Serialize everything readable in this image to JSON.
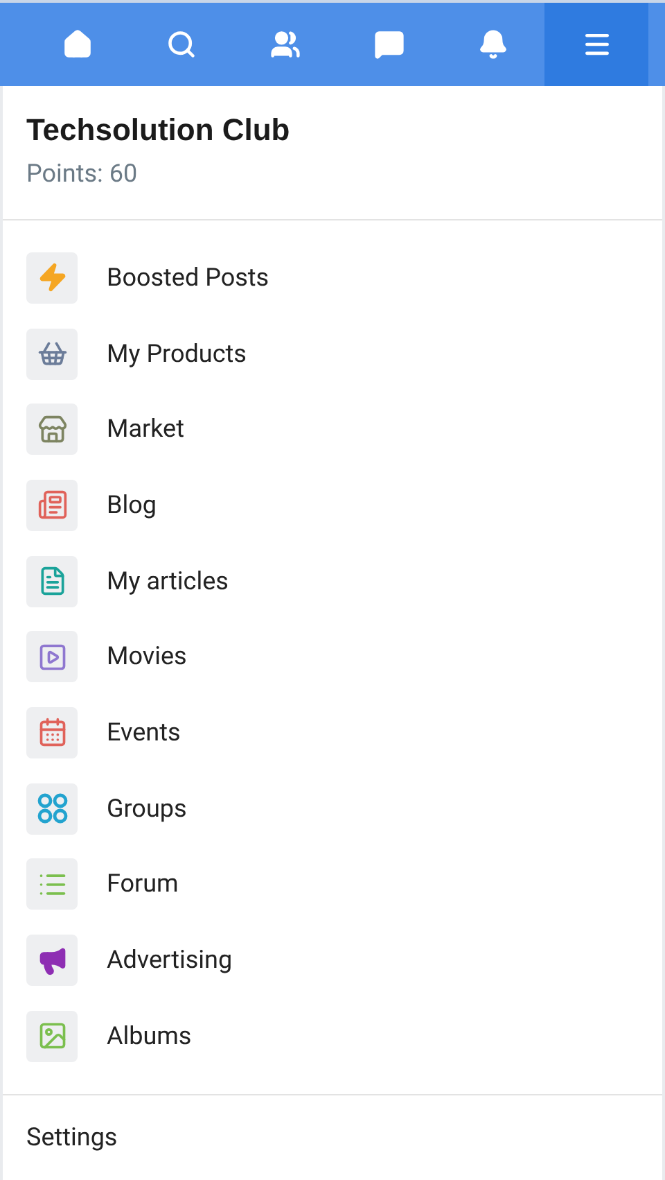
{
  "nav_tabs": [
    {
      "kind": "home",
      "selected": false
    },
    {
      "kind": "search",
      "selected": false
    },
    {
      "kind": "friends",
      "selected": false
    },
    {
      "kind": "messages",
      "selected": false
    },
    {
      "kind": "notifications",
      "selected": false
    },
    {
      "kind": "menu",
      "selected": true
    }
  ],
  "profile": {
    "name": "Techsolution Club",
    "points": "Points: 60"
  },
  "menu_items": [
    {
      "kind": "boosted",
      "label": "Boosted Posts",
      "color": "#f5a623"
    },
    {
      "kind": "products",
      "label": "My Products",
      "color": "#6b7c99"
    },
    {
      "kind": "market",
      "label": "Market",
      "color": "#7d8461"
    },
    {
      "kind": "blog",
      "label": "Blog",
      "color": "#e0625a"
    },
    {
      "kind": "articles",
      "label": "My articles",
      "color": "#1aa39a"
    },
    {
      "kind": "movies",
      "label": "Movies",
      "color": "#8f77d0"
    },
    {
      "kind": "events",
      "label": "Events",
      "color": "#e0625a"
    },
    {
      "kind": "groups",
      "label": "Groups",
      "color": "#22a3cf"
    },
    {
      "kind": "forum",
      "label": "Forum",
      "color": "#7bbf4e"
    },
    {
      "kind": "advertising",
      "label": "Advertising",
      "color": "#8e2eb3"
    },
    {
      "kind": "albums",
      "label": "Albums",
      "color": "#7bbf4e"
    }
  ],
  "settings": {
    "label": "Settings"
  }
}
